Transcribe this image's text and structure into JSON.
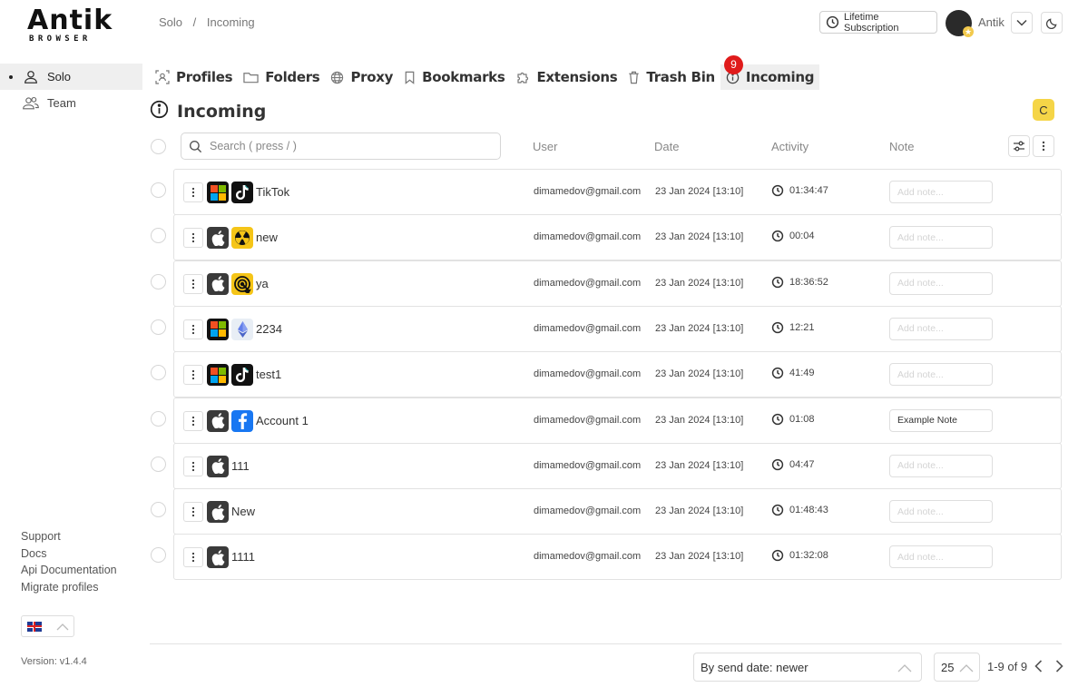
{
  "app": {
    "logo_text": "Antik",
    "logo_sub": "BROWSER",
    "version": "Version: v1.4.4"
  },
  "sidebar": {
    "items": [
      {
        "label": "Solo",
        "icon": "user-icon",
        "active": true
      },
      {
        "label": "Team",
        "icon": "users-icon",
        "active": false
      }
    ],
    "links": [
      "Support",
      "Docs",
      "Api Documentation",
      "Migrate profiles"
    ],
    "language": "en-gb"
  },
  "header": {
    "breadcrumb": [
      "Solo",
      "/",
      "Incoming"
    ],
    "subscription_label": "Lifetime Subscription",
    "user_name": "Antik"
  },
  "tabs": [
    {
      "label": "Profiles",
      "icon": "profiles-icon"
    },
    {
      "label": "Folders",
      "icon": "folder-icon"
    },
    {
      "label": "Proxy",
      "icon": "globe-icon"
    },
    {
      "label": "Bookmarks",
      "icon": "bookmark-icon"
    },
    {
      "label": "Extensions",
      "icon": "puzzle-icon"
    },
    {
      "label": "Trash Bin",
      "icon": "trash-icon"
    },
    {
      "label": "Incoming",
      "icon": "info-icon",
      "active": true,
      "badge": "9"
    }
  ],
  "page": {
    "title": "Incoming",
    "refresh_label": "C"
  },
  "table": {
    "search_placeholder": "Search ( press / )",
    "columns": {
      "user": "User",
      "date": "Date",
      "activity": "Activity",
      "note": "Note"
    },
    "note_placeholder": "Add note...",
    "rows": [
      {
        "name": "TikTok",
        "os": "windows",
        "site": "tiktok",
        "user": "dimamedov@gmail.com",
        "date": "23 Jan 2024 [13:10]",
        "activity": "01:34:47",
        "note": ""
      },
      {
        "name": "new",
        "os": "mac",
        "site": "radiation",
        "user": "dimamedov@gmail.com",
        "date": "23 Jan 2024 [13:10]",
        "activity": "00:04",
        "note": ""
      },
      {
        "name": "ya",
        "os": "mac",
        "site": "target",
        "user": "dimamedov@gmail.com",
        "date": "23 Jan 2024 [13:10]",
        "activity": "18:36:52",
        "note": ""
      },
      {
        "name": "2234",
        "os": "windows",
        "site": "ethereum",
        "user": "dimamedov@gmail.com",
        "date": "23 Jan 2024 [13:10]",
        "activity": "12:21",
        "note": ""
      },
      {
        "name": "test1",
        "os": "windows",
        "site": "tiktok",
        "user": "dimamedov@gmail.com",
        "date": "23 Jan 2024 [13:10]",
        "activity": "41:49",
        "note": ""
      },
      {
        "name": "Account 1",
        "os": "mac",
        "site": "facebook",
        "user": "dimamedov@gmail.com",
        "date": "23 Jan 2024 [13:10]",
        "activity": "01:08",
        "note": "Example Note"
      },
      {
        "name": "111",
        "os": "mac",
        "site": "",
        "user": "dimamedov@gmail.com",
        "date": "23 Jan 2024 [13:10]",
        "activity": "04:47",
        "note": ""
      },
      {
        "name": "New",
        "os": "mac",
        "site": "",
        "user": "dimamedov@gmail.com",
        "date": "23 Jan 2024 [13:10]",
        "activity": "01:48:43",
        "note": ""
      },
      {
        "name": "1111",
        "os": "mac",
        "site": "",
        "user": "dimamedov@gmail.com",
        "date": "23 Jan 2024 [13:10]",
        "activity": "01:32:08",
        "note": ""
      }
    ]
  },
  "footer": {
    "sort_label": "By send date: newer",
    "per_page": "25",
    "page_info": "1-9 of 9"
  },
  "colors": {
    "accent_yellow": "#f5d547",
    "badge_red": "#e01b1b",
    "active_bg": "#efefef"
  }
}
